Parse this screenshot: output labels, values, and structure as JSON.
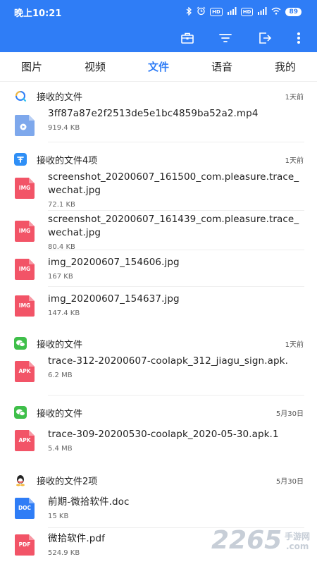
{
  "status": {
    "time": "晚上10:21",
    "hd": "HD",
    "net1": "5G",
    "net2": "4G",
    "battery": "89"
  },
  "tabs": [
    {
      "label": "图片",
      "active": false
    },
    {
      "label": "视频",
      "active": false
    },
    {
      "label": "文件",
      "active": true
    },
    {
      "label": "语音",
      "active": false
    },
    {
      "label": "我的",
      "active": false
    }
  ],
  "groups": [
    {
      "title": "接收的文件",
      "time": "1天前",
      "icon": "qq-browser-icon",
      "files": [
        {
          "name": "3ff87a87e2f2513de5e1bc4859ba52a2.mp4",
          "size": "919.4 KB",
          "type": "video",
          "badge": ""
        }
      ]
    },
    {
      "title": "接收的文件4项",
      "time": "1天前",
      "icon": "app-icon",
      "files": [
        {
          "name": "screenshot_20200607_161500_com.pleasure.trace_wechat.jpg",
          "size": "72.1 KB",
          "type": "img",
          "badge": "IMG"
        },
        {
          "name": "screenshot_20200607_161439_com.pleasure.trace_wechat.jpg",
          "size": "80.4 KB",
          "type": "img",
          "badge": "IMG"
        },
        {
          "name": "img_20200607_154606.jpg",
          "size": "167 KB",
          "type": "img",
          "badge": "IMG"
        },
        {
          "name": "img_20200607_154637.jpg",
          "size": "147.4 KB",
          "type": "img",
          "badge": "IMG"
        }
      ]
    },
    {
      "title": "接收的文件",
      "time": "1天前",
      "icon": "wechat-icon",
      "files": [
        {
          "name": "trace-312-20200607-coolapk_312_jiagu_sign.apk.",
          "size": "6.2 MB",
          "type": "apk",
          "badge": "APK"
        }
      ]
    },
    {
      "title": "接收的文件",
      "time": "5月30日",
      "icon": "wechat-icon",
      "files": [
        {
          "name": "trace-309-20200530-coolapk_2020-05-30.apk.1",
          "size": "5.4 MB",
          "type": "apk",
          "badge": "APK"
        }
      ]
    },
    {
      "title": "接收的文件2项",
      "time": "5月30日",
      "icon": "qq-icon",
      "files": [
        {
          "name": "前期-微拾软件.doc",
          "size": "15 KB",
          "type": "doc",
          "badge": "DOC"
        },
        {
          "name": "微拾软件.pdf",
          "size": "524.9 KB",
          "type": "pdf",
          "badge": "PDF"
        }
      ]
    }
  ],
  "watermark": {
    "main": "2265",
    "sub": "手游网",
    "domain": ".com"
  },
  "colors": {
    "primary": "#2f7df6",
    "img": "#f25467",
    "video": "#7ea8ec",
    "doc": "#2f7df6",
    "wechat": "#3fbf4a"
  }
}
